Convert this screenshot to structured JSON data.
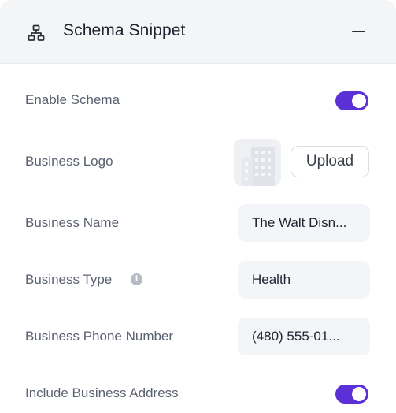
{
  "header": {
    "title": "Schema Snippet",
    "icon": "sitemap-icon",
    "collapse_icon": "minus-icon"
  },
  "fields": {
    "enable_schema": {
      "label": "Enable Schema",
      "enabled": true
    },
    "business_logo": {
      "label": "Business Logo",
      "upload_label": "Upload",
      "placeholder_icon": "building-icon"
    },
    "business_name": {
      "label": "Business Name",
      "value": "The Walt Disn..."
    },
    "business_type": {
      "label": "Business Type",
      "value": "Health",
      "info_icon": "info-icon",
      "info_glyph": "i"
    },
    "business_phone": {
      "label": "Business Phone Number",
      "value": "(480) 555-01..."
    },
    "include_address": {
      "label": "Include Business Address",
      "enabled": true
    }
  },
  "colors": {
    "accent": "#5b30d6",
    "header_bg": "#f4f5f7",
    "field_bg": "#f4f5f8"
  }
}
